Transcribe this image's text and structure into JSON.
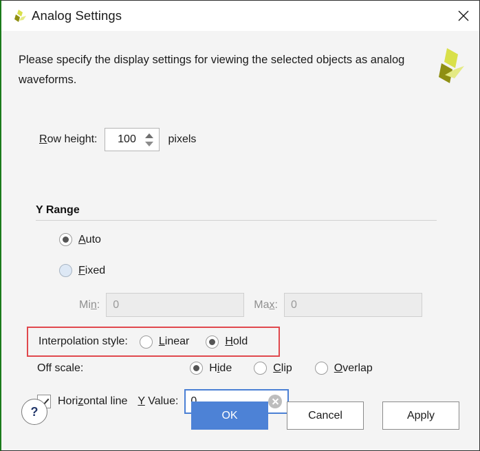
{
  "window": {
    "title": "Analog Settings",
    "logo_icon": "amd-xilinx-pinwheel-logo",
    "close_icon": "close-icon"
  },
  "intro": {
    "text": "Please specify the display settings for viewing the selected objects as analog waveforms.",
    "brand_logo_icon": "amd-xilinx-pinwheel-logo-large"
  },
  "row_height": {
    "label_pre": "",
    "label_mnemonic": "R",
    "label_post": "ow height:",
    "value": "100",
    "unit_label": "pixels",
    "spinner_up_icon": "chevron-up-icon",
    "spinner_down_icon": "chevron-down-icon"
  },
  "y_range": {
    "section_title": "Y Range",
    "auto": {
      "mnemonic": "A",
      "post": "uto",
      "selected": true
    },
    "fixed": {
      "mnemonic": "F",
      "post": "ixed",
      "selected": false
    },
    "min": {
      "label_pre": "Mi",
      "label_mnemonic": "n",
      "label_post": ":",
      "value": "0",
      "enabled": false
    },
    "max": {
      "label_pre": "Ma",
      "label_mnemonic": "x",
      "label_post": ":",
      "value": "0",
      "enabled": false
    }
  },
  "interpolation": {
    "label": "Interpolation style:",
    "highlight_color": "#e0474c",
    "linear": {
      "mnemonic": "L",
      "post": "inear",
      "selected": false
    },
    "hold": {
      "mnemonic": "H",
      "post": "old",
      "selected": true
    }
  },
  "off_scale": {
    "label": "Off scale:",
    "hide": {
      "pre": "H",
      "mnemonic": "i",
      "post": "de",
      "selected": true
    },
    "clip": {
      "pre": "",
      "mnemonic": "C",
      "post": "lip",
      "selected": false
    },
    "overlap": {
      "pre": "",
      "mnemonic": "O",
      "post": "verlap",
      "selected": false
    }
  },
  "horizontal_line": {
    "checked": true,
    "label_pre": "Hori",
    "label_mnemonic": "z",
    "label_post": "ontal line",
    "y_value_label_mnemonic": "Y",
    "y_value_label_post": " Value:",
    "y_value": "0",
    "clear_icon": "clear-circle-icon",
    "focus_color": "#4a7fd4"
  },
  "footer": {
    "help_label": "?",
    "ok_label": "OK",
    "cancel_label": "Cancel",
    "apply_label": "Apply",
    "ok_color": "#4d82d6"
  }
}
